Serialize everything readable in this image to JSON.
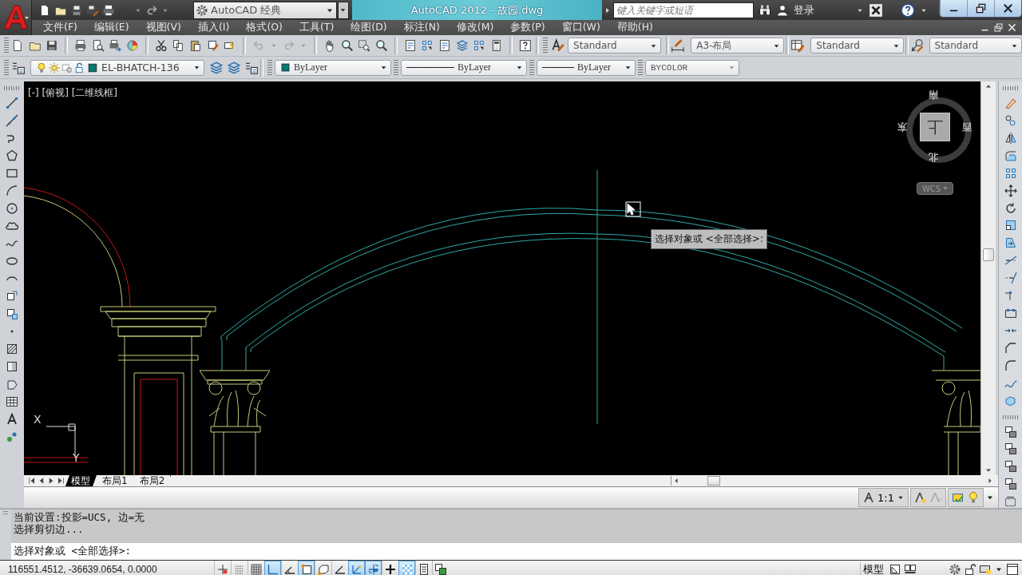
{
  "title_bar": {
    "workspace": "AutoCAD 经典",
    "title": "AutoCAD 2012 - 故园.dwg",
    "search": {
      "placeholder": "键入关键字或短语"
    },
    "sign_in": "登录"
  },
  "menu": [
    "文件(F)",
    "编辑(E)",
    "视图(V)",
    "插入(I)",
    "格式(O)",
    "工具(T)",
    "绘图(D)",
    "标注(N)",
    "修改(M)",
    "参数(P)",
    "窗口(W)",
    "帮助(H)"
  ],
  "styles_toolbar": {
    "text_style": "Standard",
    "dimension_style": "A3-布局",
    "table_style": "Standard",
    "multileader_style": "Standard"
  },
  "layers_toolbar": {
    "layer": "EL-BHATCH-136",
    "color_control": "ByLayer",
    "linetype": "ByLayer",
    "lineweight": "ByLayer",
    "plot_style": "BYCOLOR"
  },
  "viewport": {
    "controls": "[-] [俯视] [二维线框]",
    "viewcube": {
      "top": "南",
      "left": "东",
      "right": "西",
      "bottom": "北",
      "face": "上",
      "ucs": "WCS"
    },
    "tooltip": "选择对象或 <全部选择>:",
    "ucs_icon": {
      "x_label": "X",
      "y_label": "Y"
    }
  },
  "layout_tabs": [
    {
      "label": "模型",
      "selected": true
    },
    {
      "label": "布局1",
      "selected": false
    },
    {
      "label": "布局2",
      "selected": false
    }
  ],
  "annotation_scale": "1:1",
  "command_history": [
    "当前设置:投影=UCS, 边=无",
    "选择剪切边..."
  ],
  "command_prompt": "选择对象或 <全部选择>:",
  "status_bar": {
    "coordinates": "116551.4512, -36639.0654, 0.0000",
    "space": "模型",
    "toggles": [
      {
        "on": false
      },
      {
        "on": false
      },
      {
        "on": false
      },
      {
        "on": true
      },
      {
        "on": false
      },
      {
        "on": true
      },
      {
        "on": false
      },
      {
        "on": false
      },
      {
        "on": true
      },
      {
        "on": true
      },
      {
        "on": false
      },
      {
        "on": true
      },
      {
        "on": false
      },
      {
        "on": false
      }
    ]
  }
}
